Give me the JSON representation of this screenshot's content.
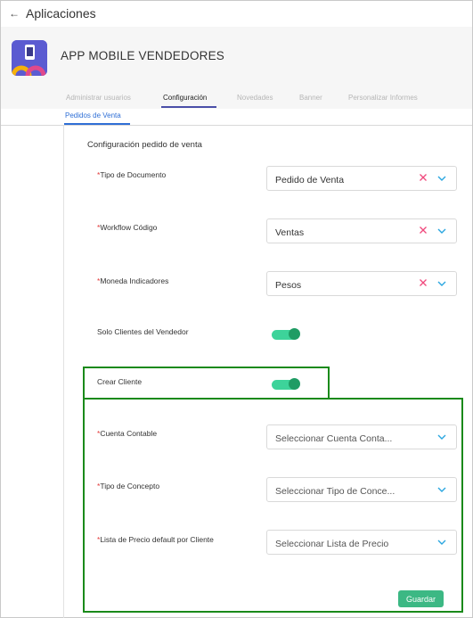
{
  "topbar": {
    "back_icon": "arrow-left-icon",
    "title": "Aplicaciones"
  },
  "app": {
    "logo_icon": "mobile-app-logo-icon",
    "title": "APP MOBILE VENDEDORES"
  },
  "tabs": [
    {
      "label": "Administrar usuarios",
      "active": false
    },
    {
      "label": "Configuración",
      "active": true
    },
    {
      "label": "Novedades",
      "active": false
    },
    {
      "label": "Banner",
      "active": false
    },
    {
      "label": "Personalizar Informes",
      "active": false
    }
  ],
  "subtab": {
    "label": "Pedidos de Venta",
    "active": true
  },
  "form": {
    "section_title": "Configuración pedido de venta",
    "required_mark": "*",
    "tipo_documento": {
      "label": "Tipo de Documento",
      "value": "Pedido de Venta"
    },
    "workflow": {
      "label": "Workflow Código",
      "value": "Ventas"
    },
    "moneda": {
      "label": "Moneda Indicadores",
      "value": "Pesos"
    },
    "solo_clientes": {
      "label": "Solo Clientes del Vendedor",
      "enabled": true
    },
    "crear_cliente": {
      "label": "Crear Cliente",
      "enabled": true
    },
    "cuenta_contable": {
      "label": "Cuenta Contable",
      "placeholder": "Seleccionar Cuenta Conta..."
    },
    "tipo_concepto": {
      "label": "Tipo de Concepto",
      "placeholder": "Seleccionar Tipo de Conce..."
    },
    "lista_precio": {
      "label": "Lista de Precio default por Cliente",
      "placeholder": "Seleccionar Lista de Precio"
    },
    "save_label": "Guardar"
  },
  "colors": {
    "accent": "#3cb884",
    "toggle_on": "#3dd39a",
    "link": "#2f6fd6",
    "required": "#e23b3b",
    "highlight": "#1a8a1a"
  }
}
